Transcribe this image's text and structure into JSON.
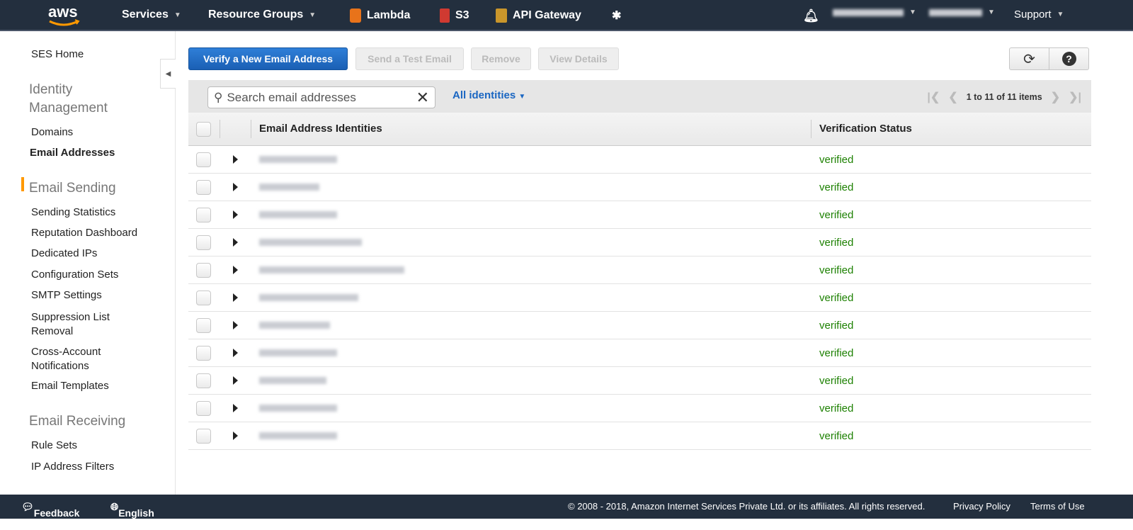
{
  "topnav": {
    "logo": "aws",
    "services": "Services",
    "resource_groups": "Resource Groups",
    "shortcuts": [
      "Lambda",
      "S3",
      "API Gateway"
    ],
    "support": "Support"
  },
  "sidebar": {
    "ses_home": "SES Home",
    "sections": [
      {
        "title": "Identity Management",
        "items": [
          "Domains",
          "Email Addresses"
        ]
      },
      {
        "title": "Email Sending",
        "items": [
          "Sending Statistics",
          "Reputation Dashboard",
          "Dedicated IPs",
          "Configuration Sets",
          "SMTP Settings",
          "Suppression List Removal",
          "Cross-Account Notifications",
          "Email Templates"
        ]
      },
      {
        "title": "Email Receiving",
        "items": [
          "Rule Sets",
          "IP Address Filters"
        ]
      }
    ],
    "active": "Email Addresses"
  },
  "toolbar": {
    "verify": "Verify a New Email Address",
    "send_test": "Send a Test Email",
    "remove": "Remove",
    "view_details": "View Details"
  },
  "filter": {
    "search_placeholder": "Search email addresses",
    "scope": "All identities",
    "pager": "1 to 11 of 11 items"
  },
  "table": {
    "columns": [
      "Email Address Identities",
      "Verification Status"
    ],
    "rows": [
      "verified",
      "verified",
      "verified",
      "verified",
      "verified",
      "verified",
      "verified",
      "verified",
      "verified",
      "verified",
      "verified"
    ]
  },
  "footer": {
    "feedback": "Feedback",
    "language": "English (US)",
    "copyright": "© 2008 - 2018, Amazon Internet Services Private Ltd. or its affiliates. All rights reserved.",
    "privacy": "Privacy Policy",
    "terms": "Terms of Use"
  },
  "colors": {
    "topbar": "#232f3e",
    "primary": "#1a5fb4",
    "verified": "#1d8102",
    "accent": "#ff9900"
  }
}
